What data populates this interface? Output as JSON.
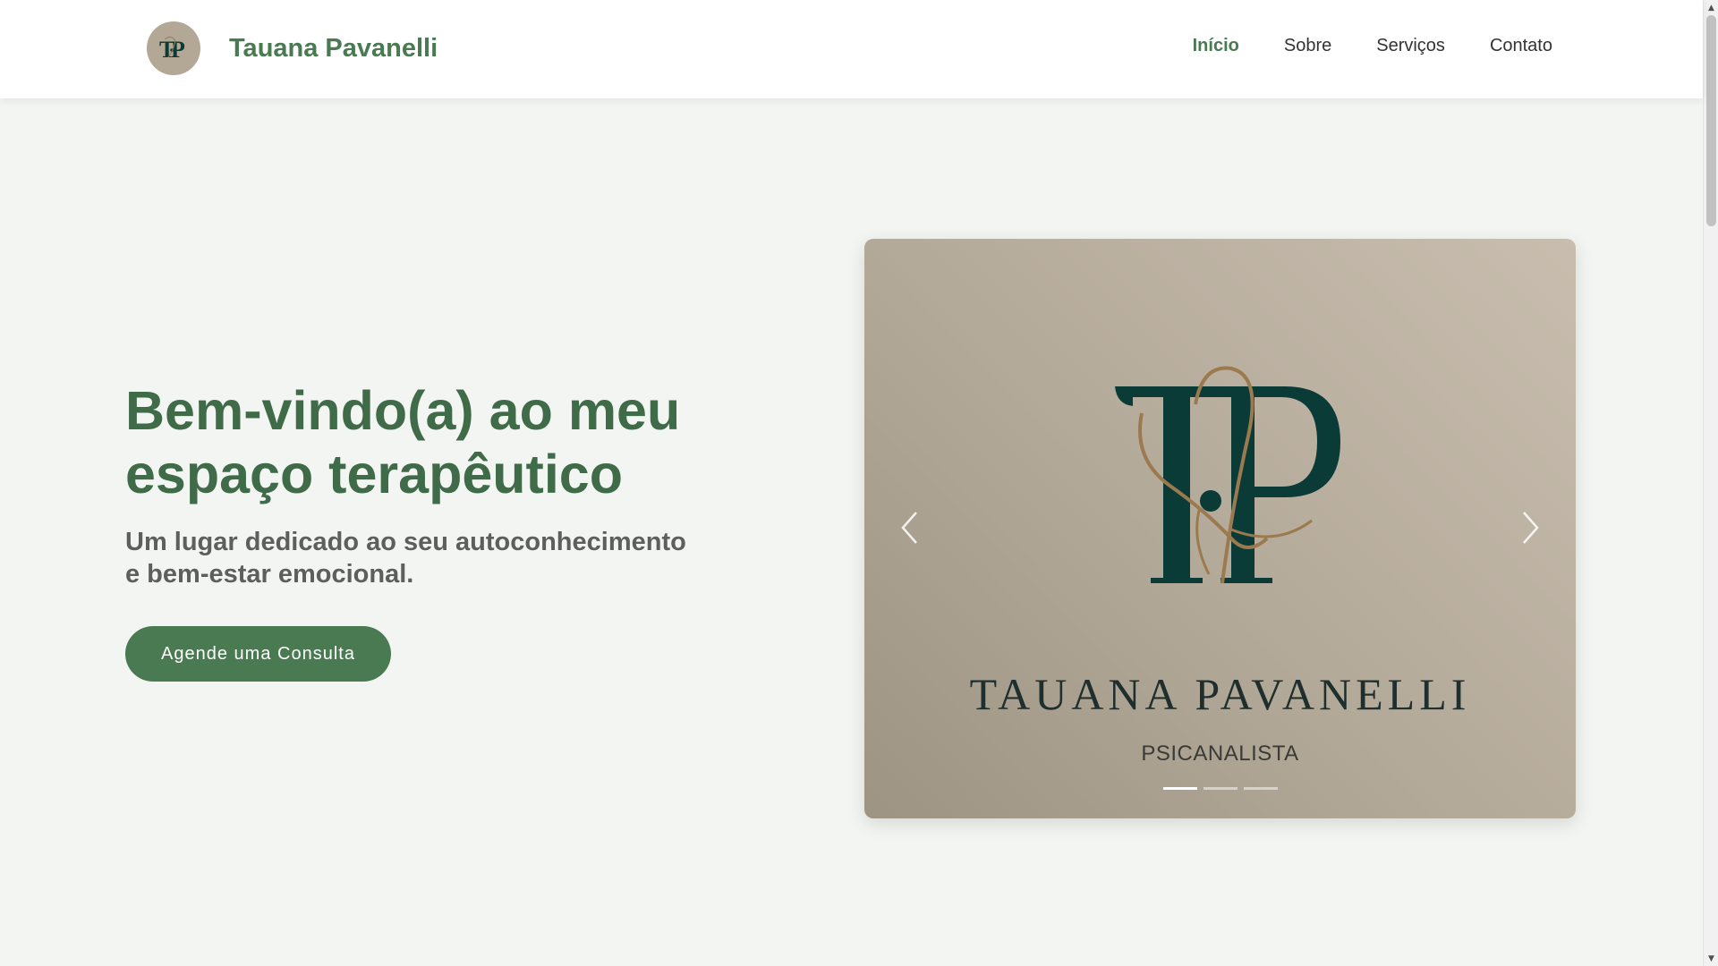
{
  "header": {
    "brand_name": "Tauana Pavanelli",
    "logo_letters": "TP",
    "nav": [
      {
        "label": "Início",
        "active": true
      },
      {
        "label": "Sobre",
        "active": false
      },
      {
        "label": "Serviços",
        "active": false
      },
      {
        "label": "Contato",
        "active": false
      }
    ]
  },
  "hero": {
    "title_line1": "Bem-vindo(a) ao meu",
    "title_line2": "espaço terapêutico",
    "subtitle_line1": "Um lugar dedicado ao seu autoconhecimento",
    "subtitle_line2": "e bem-estar emocional.",
    "cta_label": "Agende uma Consulta"
  },
  "carousel": {
    "slide_title": "TAUANA PAVANELLI",
    "slide_subtitle": "PSICANALISTA",
    "prev_icon": "chevron-left-icon",
    "next_icon": "chevron-right-icon",
    "slide_count": 3,
    "active_index": 0
  },
  "colors": {
    "brand_green": "#4a7a52",
    "title_green": "#3f6b48",
    "logo_teal": "#0b3b37",
    "logo_gold": "#9c7a4f",
    "background": "#f3f5f2"
  },
  "scrollbar": {
    "up_icon": "scroll-up-arrow-icon",
    "down_icon": "scroll-down-arrow-icon"
  }
}
